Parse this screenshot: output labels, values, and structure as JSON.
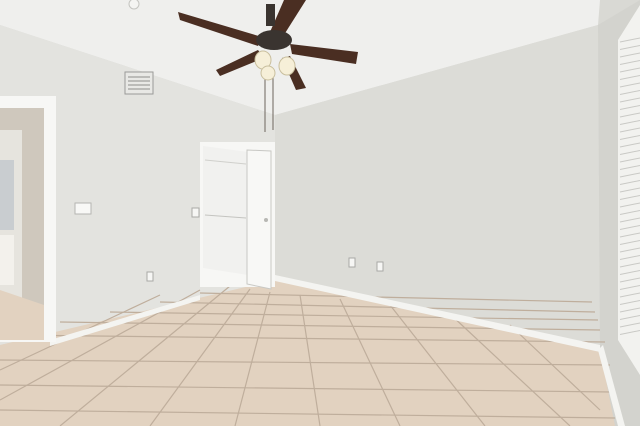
{
  "scene": {
    "description_hidden": "",
    "colors": {
      "ceiling": "#efefed",
      "left_wall": "#e3e3df",
      "back_wall": "#dcdcd7",
      "right_wall": "#d3d3ce",
      "floor_tile": "#e2d2c0",
      "grout": "#bfae9c",
      "baseboard": "#f4f4f1",
      "trim": "#f7f7f5",
      "closet_interior": "#f1f1ef",
      "fan_blade": "#4a2e22",
      "fan_body": "#3a3430",
      "light_glass": "#f6efd8",
      "window_blind": "#f2f2ef"
    },
    "objects": [
      "ceiling-fan",
      "air-vent",
      "closet-door",
      "walk-in-closet",
      "bathroom-doorway",
      "light-switch",
      "outlets",
      "window-blinds",
      "tile-floor"
    ]
  }
}
